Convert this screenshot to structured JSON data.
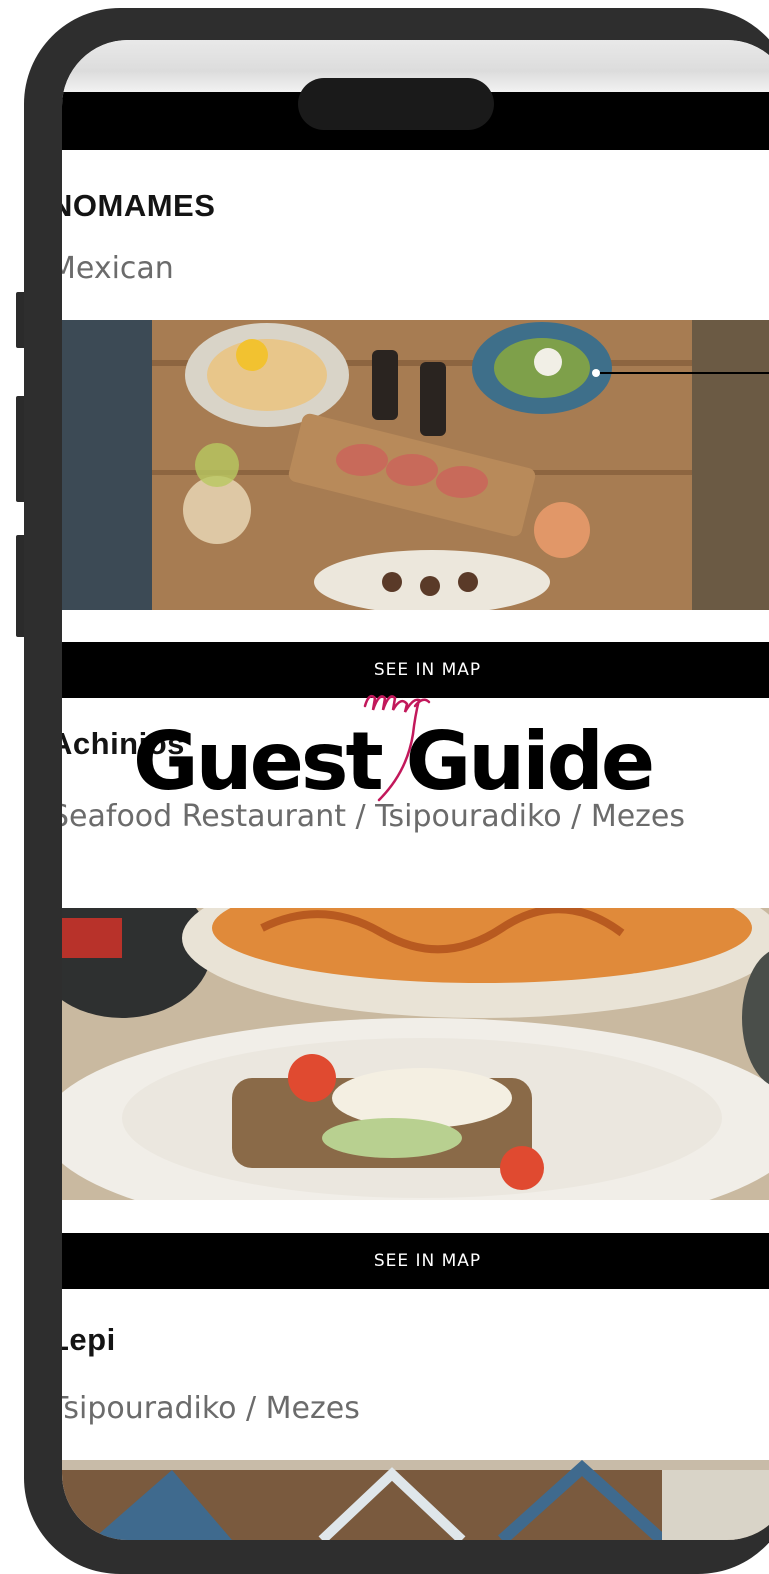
{
  "brand": {
    "script": "my",
    "name": "Guest Guide",
    "accent_color": "#c2185b"
  },
  "restaurants": [
    {
      "name": "NOMAMES",
      "type": "Mexican",
      "map_label": "SEE IN MAP",
      "photo_icon": "food-table-photo"
    },
    {
      "name": "Achinios",
      "type": "Seafood Restaurant / Tsipouradiko / Mezes",
      "map_label": "SEE IN MAP",
      "photo_icon": "pasta-dish-photo"
    },
    {
      "name": "Lepi",
      "type": "Tsipouradiko / Mezes",
      "photo_icon": "taverna-chairs-photo"
    }
  ],
  "colors": {
    "frame": "#2e2e2e",
    "bar": "#000000",
    "subtitle": "#6b6b6b"
  }
}
